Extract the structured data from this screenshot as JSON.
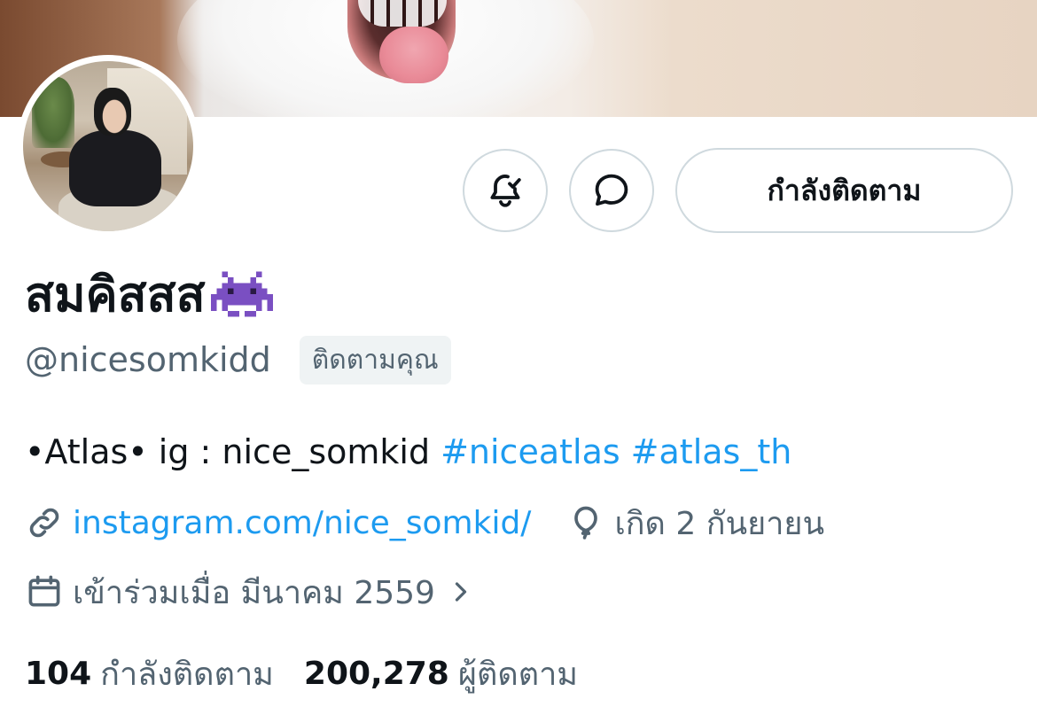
{
  "profile": {
    "display_name": "สมคิสสส",
    "handle": "@nicesomkidd",
    "follows_you_label": "ติดตามคุณ",
    "bio_text": "•Atlas• ig : nice_somkid",
    "bio_hashtags": [
      "#niceatlas",
      "#atlas_th"
    ],
    "website": "instagram.com/nice_somkid/",
    "birthday": "เกิด 2 กันยายน",
    "joined": "เข้าร่วมเมื่อ มีนาคม 2559"
  },
  "actions": {
    "notifications_icon": "bell-check-icon",
    "message_icon": "message-bubble-icon",
    "follow_label": "กำลังติดตาม"
  },
  "stats": {
    "following_count": "104",
    "following_label": "กำลังติดตาม",
    "followers_count": "200,278",
    "followers_label": "ผู้ติดตาม"
  },
  "colors": {
    "accent": "#1d9bf0",
    "text_primary": "#0f1419",
    "text_secondary": "#536471",
    "border": "#cfd9de"
  }
}
